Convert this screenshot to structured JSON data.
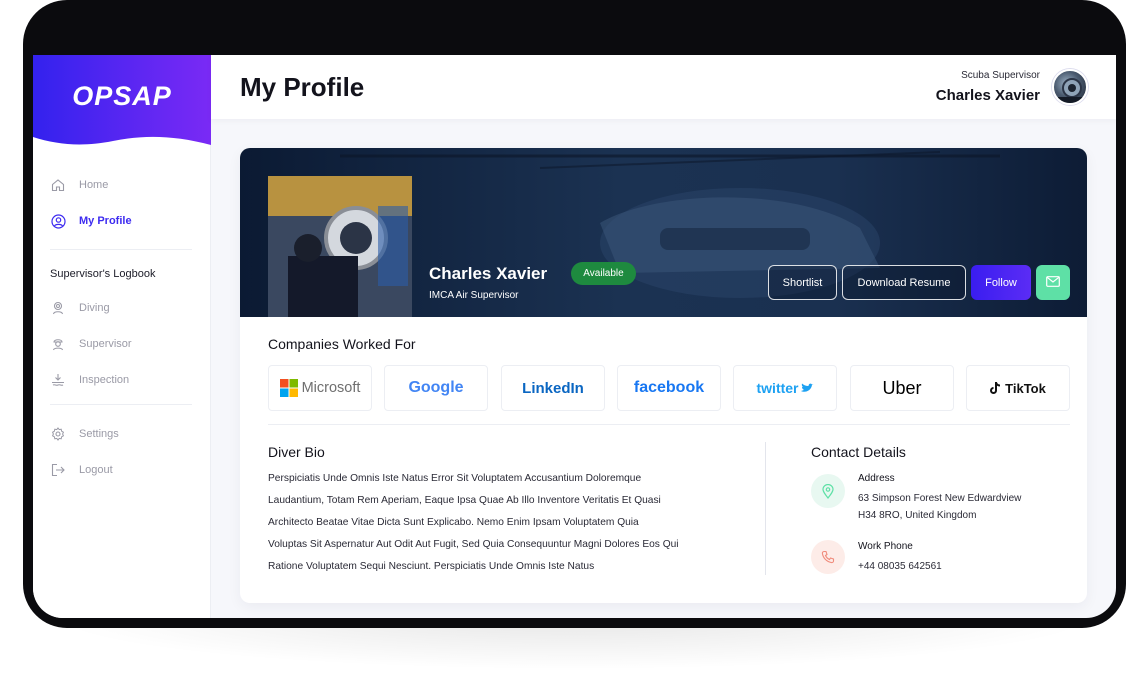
{
  "brand": {
    "name": "OPSAP"
  },
  "sidebar": {
    "items": [
      {
        "label": "Home",
        "icon": "home-icon"
      },
      {
        "label": "My Profile",
        "icon": "user-circle-icon",
        "active": true
      }
    ],
    "section_heading": "Supervisor's Logbook",
    "logbook_items": [
      {
        "label": "Diving",
        "icon": "diver-icon"
      },
      {
        "label": "Supervisor",
        "icon": "supervisor-icon"
      },
      {
        "label": "Inspection",
        "icon": "inspection-icon"
      }
    ],
    "bottom_items": [
      {
        "label": "Settings",
        "icon": "gear-icon"
      },
      {
        "label": "Logout",
        "icon": "logout-icon"
      }
    ]
  },
  "header": {
    "title": "My Profile",
    "user_role": "Scuba Supervisor",
    "user_name": "Charles Xavier"
  },
  "profile": {
    "name": "Charles Xavier",
    "status": "Available",
    "role": "IMCA Air Supervisor",
    "actions": {
      "shortlist": "Shortlist",
      "download": "Download Resume",
      "follow": "Follow"
    }
  },
  "companies": {
    "title": "Companies Worked For",
    "list": [
      "Microsoft",
      "Google",
      "LinkedIn",
      "facebook",
      "twitter",
      "Uber",
      "TikTok"
    ]
  },
  "bio": {
    "title": "Diver Bio",
    "lines": [
      "Perspiciatis Unde Omnis Iste Natus Error Sit Voluptatem Accusantium Doloremque",
      "Laudantium, Totam Rem Aperiam, Eaque Ipsa Quae Ab Illo Inventore Veritatis Et Quasi",
      "Architecto Beatae Vitae Dicta Sunt Explicabo. Nemo Enim Ipsam Voluptatem Quia",
      "Voluptas Sit Aspernatur Aut Odit Aut Fugit, Sed Quia Consequuntur Magni Dolores Eos Qui",
      "Ratione Voluptatem Sequi Nesciunt.  Perspiciatis Unde Omnis Iste Natus"
    ]
  },
  "contact": {
    "title": "Contact Details",
    "address_label": "Address",
    "address_line1": "63 Simpson Forest New Edwardview",
    "address_line2": "H34 8RO, United Kingdom",
    "phone_label": "Work Phone",
    "phone": "+44 08035 642561"
  },
  "colors": {
    "accent": "#3d2bf0",
    "available": "#1e8a3f",
    "mail": "#5ee0a6"
  }
}
